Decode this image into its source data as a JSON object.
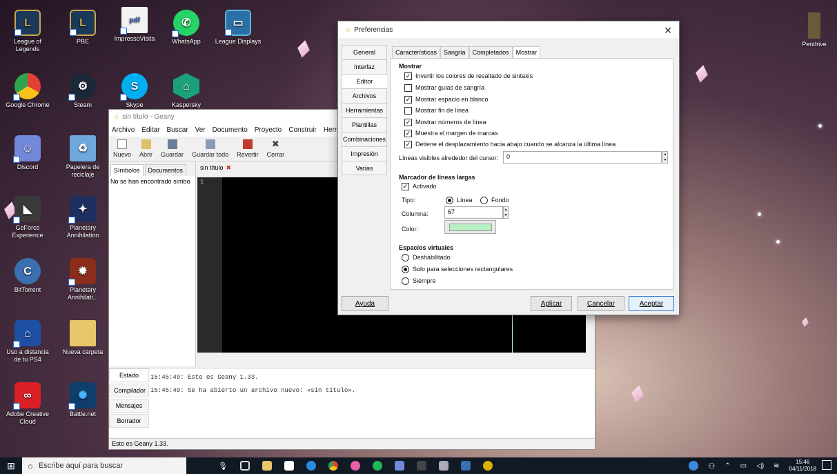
{
  "desktop": {
    "icons": [
      {
        "label": "League of Legends",
        "color": "#1b3a59"
      },
      {
        "label": "PBE",
        "color": "#1b3a59"
      },
      {
        "label": "ImpressoVisita",
        "color": "#f2f2f2"
      },
      {
        "label": "WhatsApp",
        "color": "#25d366"
      },
      {
        "label": "League Displays",
        "color": "#2b6fa6"
      },
      {
        "label": "Google Chrome",
        "color": "#e34133"
      },
      {
        "label": "Steam",
        "color": "#1b2838"
      },
      {
        "label": "Skype",
        "color": "#00aff0"
      },
      {
        "label": "Kaspersky Secure",
        "color": "#1aa179"
      },
      {
        "label": "Discord",
        "color": "#7289da"
      },
      {
        "label": "Papelera de reciclaje",
        "color": "#6fa8dc"
      },
      {
        "label": "GeForce Experience",
        "color": "#3a3a3a"
      },
      {
        "label": "Planetary Annihilation",
        "color": "#1e2f5f"
      },
      {
        "label": "BitTorrent",
        "color": "#3a6fb0"
      },
      {
        "label": "Planetary Annihilati...",
        "color": "#8a2d1a"
      },
      {
        "label": "Uso a distancia de tu PS4",
        "color": "#1d4fa3"
      },
      {
        "label": "Nueva carpeta",
        "color": "#e7c66b"
      },
      {
        "label": "Adobe Creative Cloud",
        "color": "#da1f26"
      },
      {
        "label": "Battle.net",
        "color": "#0e3e6b"
      },
      {
        "label": "Pendrive",
        "color": "#6b5a3a"
      }
    ],
    "pdf_label": "pdf"
  },
  "geany": {
    "title": "sin título - Geany",
    "menu": [
      "Archivo",
      "Editar",
      "Buscar",
      "Ver",
      "Documento",
      "Proyecto",
      "Construir",
      "Herran"
    ],
    "toolbar": [
      "Nuevo",
      "Abrir",
      "Guardar",
      "Guardar todo",
      "Revertir",
      "Cerrar"
    ],
    "side_tabs": [
      "Símbolos",
      "Documentos"
    ],
    "side_message": "No se han encontrado símbo",
    "editor_tab": "sin título",
    "line_number": "1",
    "bottom_tabs": [
      "Estado",
      "Compilador",
      "Mensajes",
      "Borrador"
    ],
    "log": [
      "15:45:49: Esto es Geany 1.33.",
      "15:45:49: Se ha abierto un archivo nuevo: «sin título»."
    ],
    "status": "Esto es Geany 1.33."
  },
  "prefs": {
    "title": "Preferencias",
    "close": "✕",
    "categories": [
      "General",
      "Interfaz",
      "Editor",
      "Archivos",
      "Herramientas",
      "Plantillas",
      "Combinaciones",
      "Impresión",
      "Varias"
    ],
    "subtabs": [
      "Características",
      "Sangría",
      "Completados",
      "Mostrar"
    ],
    "section_mostrar": "Mostrar",
    "options": [
      {
        "label": "Invertir los colores de resaltado de sintaxis",
        "checked": true
      },
      {
        "label": "Mostrar guías de sangría",
        "checked": false
      },
      {
        "label": "Mostrar espacio en blanco",
        "checked": true
      },
      {
        "label": "Mostrar fin de línea",
        "checked": false
      },
      {
        "label": "Mostrar números de línea",
        "checked": true
      },
      {
        "label": "Muestra el margen de marcas",
        "checked": true
      },
      {
        "label": "Detiene el desplazamiento hacia abajo cuando se alcanza la última línea",
        "checked": true
      }
    ],
    "visible_lines_label": "Líneas visibles alrededor del cursor:",
    "visible_lines_value": "0",
    "long_lines_header": "Marcador de líneas largas",
    "activated_label": "Activado",
    "type_label": "Tipo:",
    "type_line": "Línea",
    "type_background": "Fondo",
    "column_label": "Columna:",
    "column_value": "67",
    "color_label": "Color:",
    "color_value": "#b9efc4",
    "virtual_header": "Espacios virtuales",
    "virtual_options": [
      "Deshabilitado",
      "Solo para selecciones rectangulares",
      "Siempre"
    ],
    "help": "Ayuda",
    "apply": "Aplicar",
    "cancel": "Cancelar",
    "accept": "Aceptar"
  },
  "taskbar": {
    "search_placeholder": "Escribe aquí para buscar",
    "time": "15:46",
    "date": "04/11/2018"
  }
}
